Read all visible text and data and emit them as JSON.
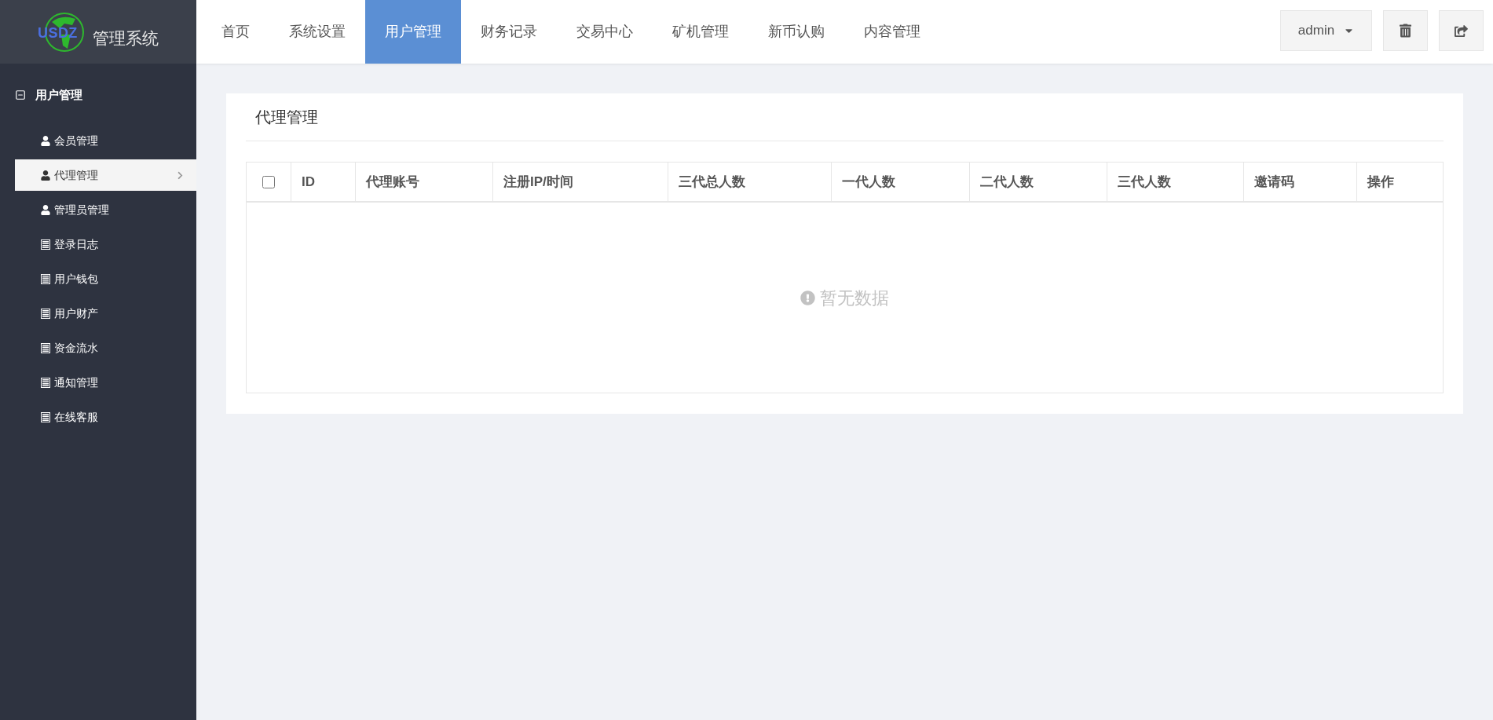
{
  "logo": {
    "mark": "USDZ",
    "title": "管理系统"
  },
  "top_nav": [
    {
      "label": "首页",
      "selected": false
    },
    {
      "label": "系统设置",
      "selected": false
    },
    {
      "label": "用户管理",
      "selected": true
    },
    {
      "label": "财务记录",
      "selected": false
    },
    {
      "label": "交易中心",
      "selected": false
    },
    {
      "label": "矿机管理",
      "selected": false
    },
    {
      "label": "新币认购",
      "selected": false
    },
    {
      "label": "内容管理",
      "selected": false
    }
  ],
  "user_menu": {
    "label": "admin"
  },
  "sidebar": {
    "group": {
      "label": "用户管理",
      "expanded": true
    },
    "items": [
      {
        "label": "会员管理",
        "kind": "user",
        "selected": false
      },
      {
        "label": "代理管理",
        "kind": "user",
        "selected": true
      },
      {
        "label": "管理员管理",
        "kind": "user",
        "selected": false
      },
      {
        "label": "登录日志",
        "kind": "list",
        "selected": false
      },
      {
        "label": "用户钱包",
        "kind": "list",
        "selected": false
      },
      {
        "label": "用户财产",
        "kind": "list",
        "selected": false
      },
      {
        "label": "资金流水",
        "kind": "list",
        "selected": false
      },
      {
        "label": "通知管理",
        "kind": "list",
        "selected": false
      },
      {
        "label": "在线客服",
        "kind": "list",
        "selected": false
      }
    ]
  },
  "panel": {
    "title": "代理管理"
  },
  "table": {
    "select_all": {
      "checked": false
    },
    "columns": [
      "ID",
      "代理账号",
      "注册IP/时间",
      "三代总人数",
      "一代人数",
      "二代人数",
      "三代人数",
      "邀请码",
      "操作"
    ],
    "empty_text": "暂无数据"
  }
}
